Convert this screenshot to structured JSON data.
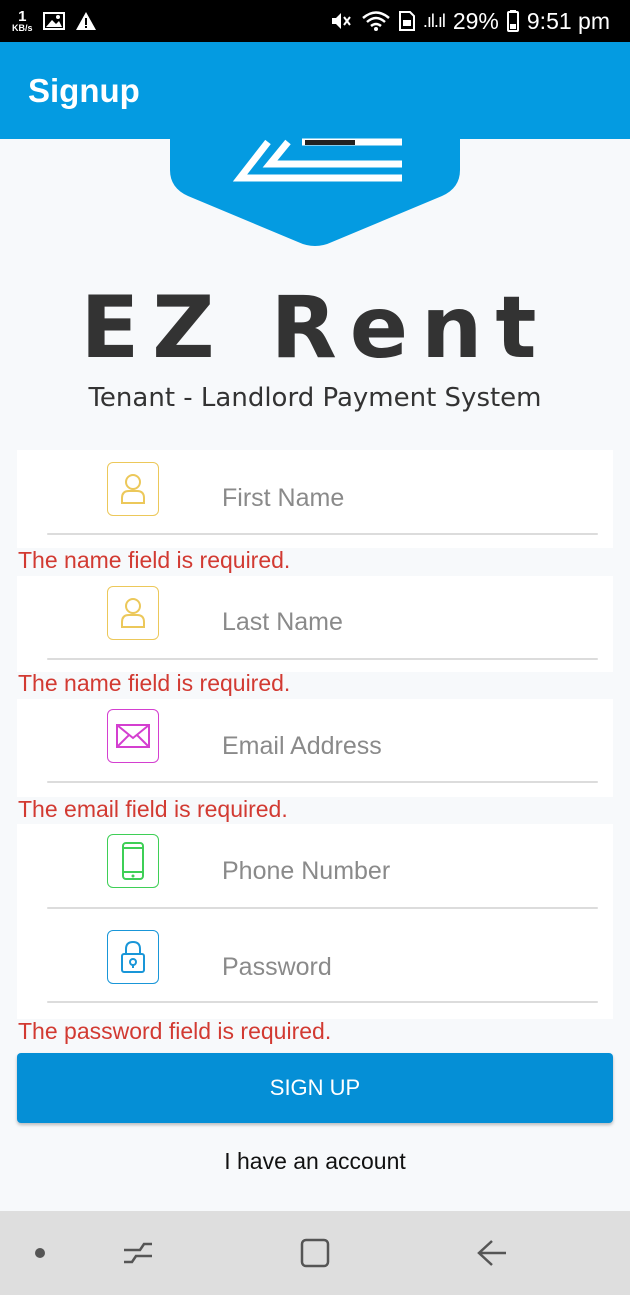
{
  "status_bar": {
    "speed_value": "1",
    "speed_unit": "KB/s",
    "battery": "29%",
    "time": "9:51 pm"
  },
  "app_bar": {
    "title": "Signup"
  },
  "brand": {
    "name": "EZ Rent",
    "tagline": "Tenant - Landlord Payment System"
  },
  "form": {
    "first_name": {
      "placeholder": "First Name",
      "value": "",
      "error": "The name field is required.",
      "icon": "user-icon",
      "icon_color": "#ecc85a"
    },
    "last_name": {
      "placeholder": "Last Name",
      "value": "",
      "error": "The name field is required.",
      "icon": "user-icon",
      "icon_color": "#ecc85a"
    },
    "email": {
      "placeholder": "Email Address",
      "value": "",
      "error": "The email field is required.",
      "icon": "envelope-icon",
      "icon_color": "#d43fd0"
    },
    "phone": {
      "placeholder": "Phone Number",
      "value": "",
      "icon": "phone-icon",
      "icon_color": "#3ecf56"
    },
    "password": {
      "placeholder": "Password",
      "value": "",
      "error": "The password field is required.",
      "icon": "lock-icon",
      "icon_color": "#1996d8"
    }
  },
  "buttons": {
    "signup_label": "SIGN UP",
    "login_link": "I have an account"
  },
  "colors": {
    "primary": "#049be1",
    "button": "#058fd6",
    "error": "#d23a32",
    "text_dark": "#333333"
  },
  "nav_bar": {
    "items": [
      "dot-icon",
      "recent-apps-icon",
      "home-icon",
      "back-icon"
    ]
  }
}
